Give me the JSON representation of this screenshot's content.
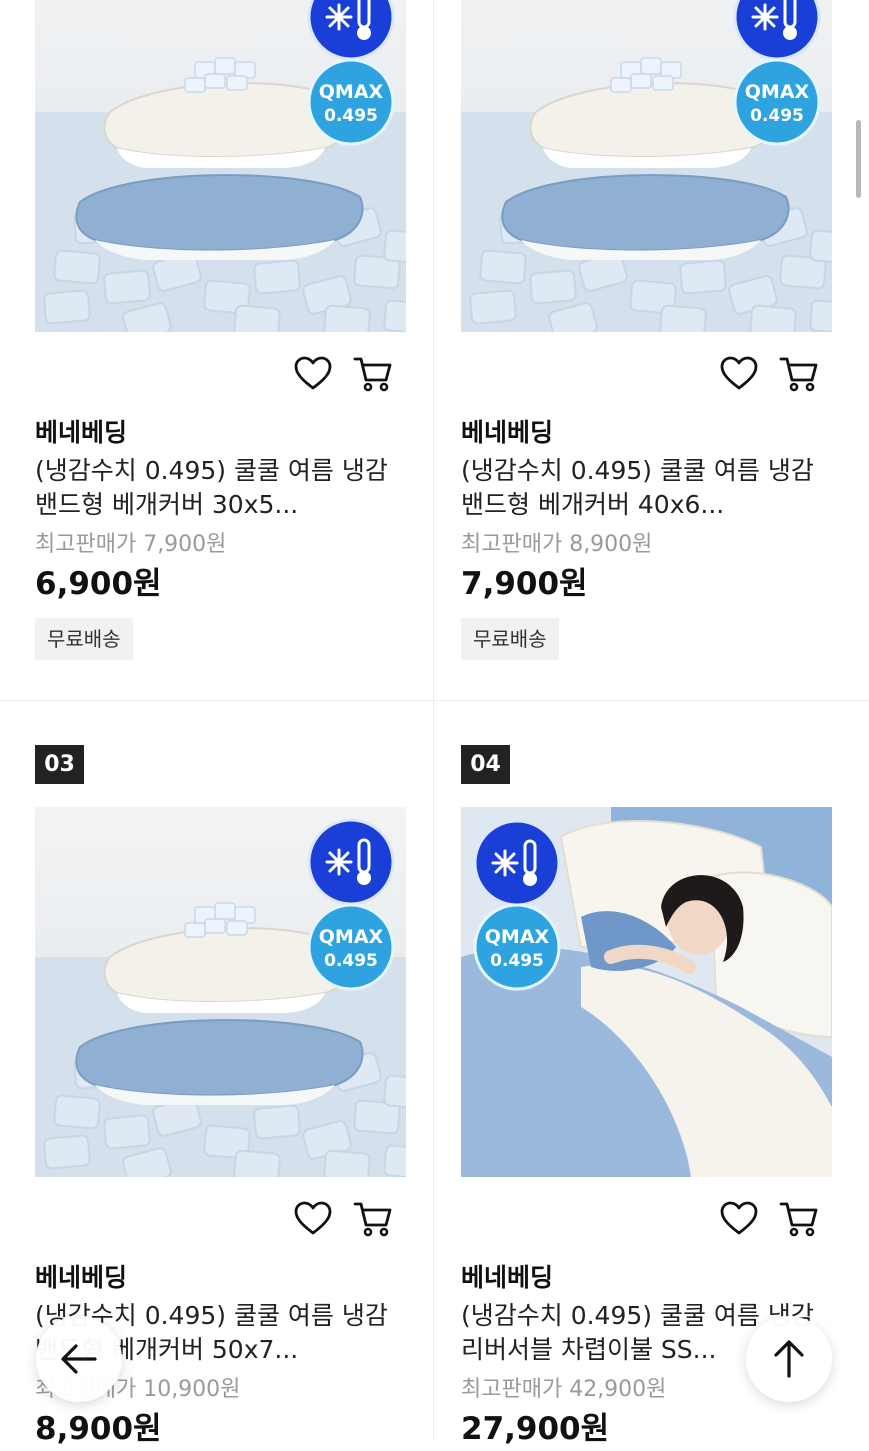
{
  "products": [
    {
      "rank": "",
      "brand": "베네베딩",
      "name": "(냉감수치 0.495) 쿨쿨 여름 냉감 밴드형 베개커버 30x5...",
      "original_price": "최고판매가 7,900원",
      "price": "6,900원",
      "badge": "무료배송",
      "badge_cool": "QMAX",
      "badge_value": "0.495",
      "image": "pillow-on-ice"
    },
    {
      "rank": "",
      "brand": "베네베딩",
      "name": "(냉감수치 0.495) 쿨쿨 여름 냉감 밴드형 베개커버 40x6...",
      "original_price": "최고판매가 8,900원",
      "price": "7,900원",
      "badge": "무료배송",
      "badge_cool": "QMAX",
      "badge_value": "0.495",
      "image": "pillow-on-ice"
    },
    {
      "rank": "03",
      "brand": "베네베딩",
      "name": "(냉감수치 0.495) 쿨쿨 여름 냉감 밴드형 베개커버 50x7...",
      "original_price": "최고판매가 10,900원",
      "price": "8,900원",
      "badge": "",
      "badge_cool": "QMAX",
      "badge_value": "0.495",
      "image": "pillow-on-ice"
    },
    {
      "rank": "04",
      "brand": "베네베딩",
      "name": "(냉감수치 0.495) 쿨쿨 여름 냉감 리버서블 차렵이불 SS...",
      "original_price": "최고판매가 42,900원",
      "price": "27,900원",
      "badge": "",
      "badge_cool": "QMAX",
      "badge_value": "0.495",
      "image": "woman-sleeping-in-bed"
    }
  ],
  "icons": {
    "wishlist": "heart-icon",
    "cart": "cart-icon",
    "back": "arrow-left-icon",
    "top": "arrow-up-icon",
    "cool": "snowflake-thermometer-icon"
  },
  "colors": {
    "badge_blue": "#1a3fd6",
    "badge_cyan": "#2fa3e0",
    "rank_bg": "#222222",
    "price": "#111111",
    "muted": "#9a9a9a"
  }
}
